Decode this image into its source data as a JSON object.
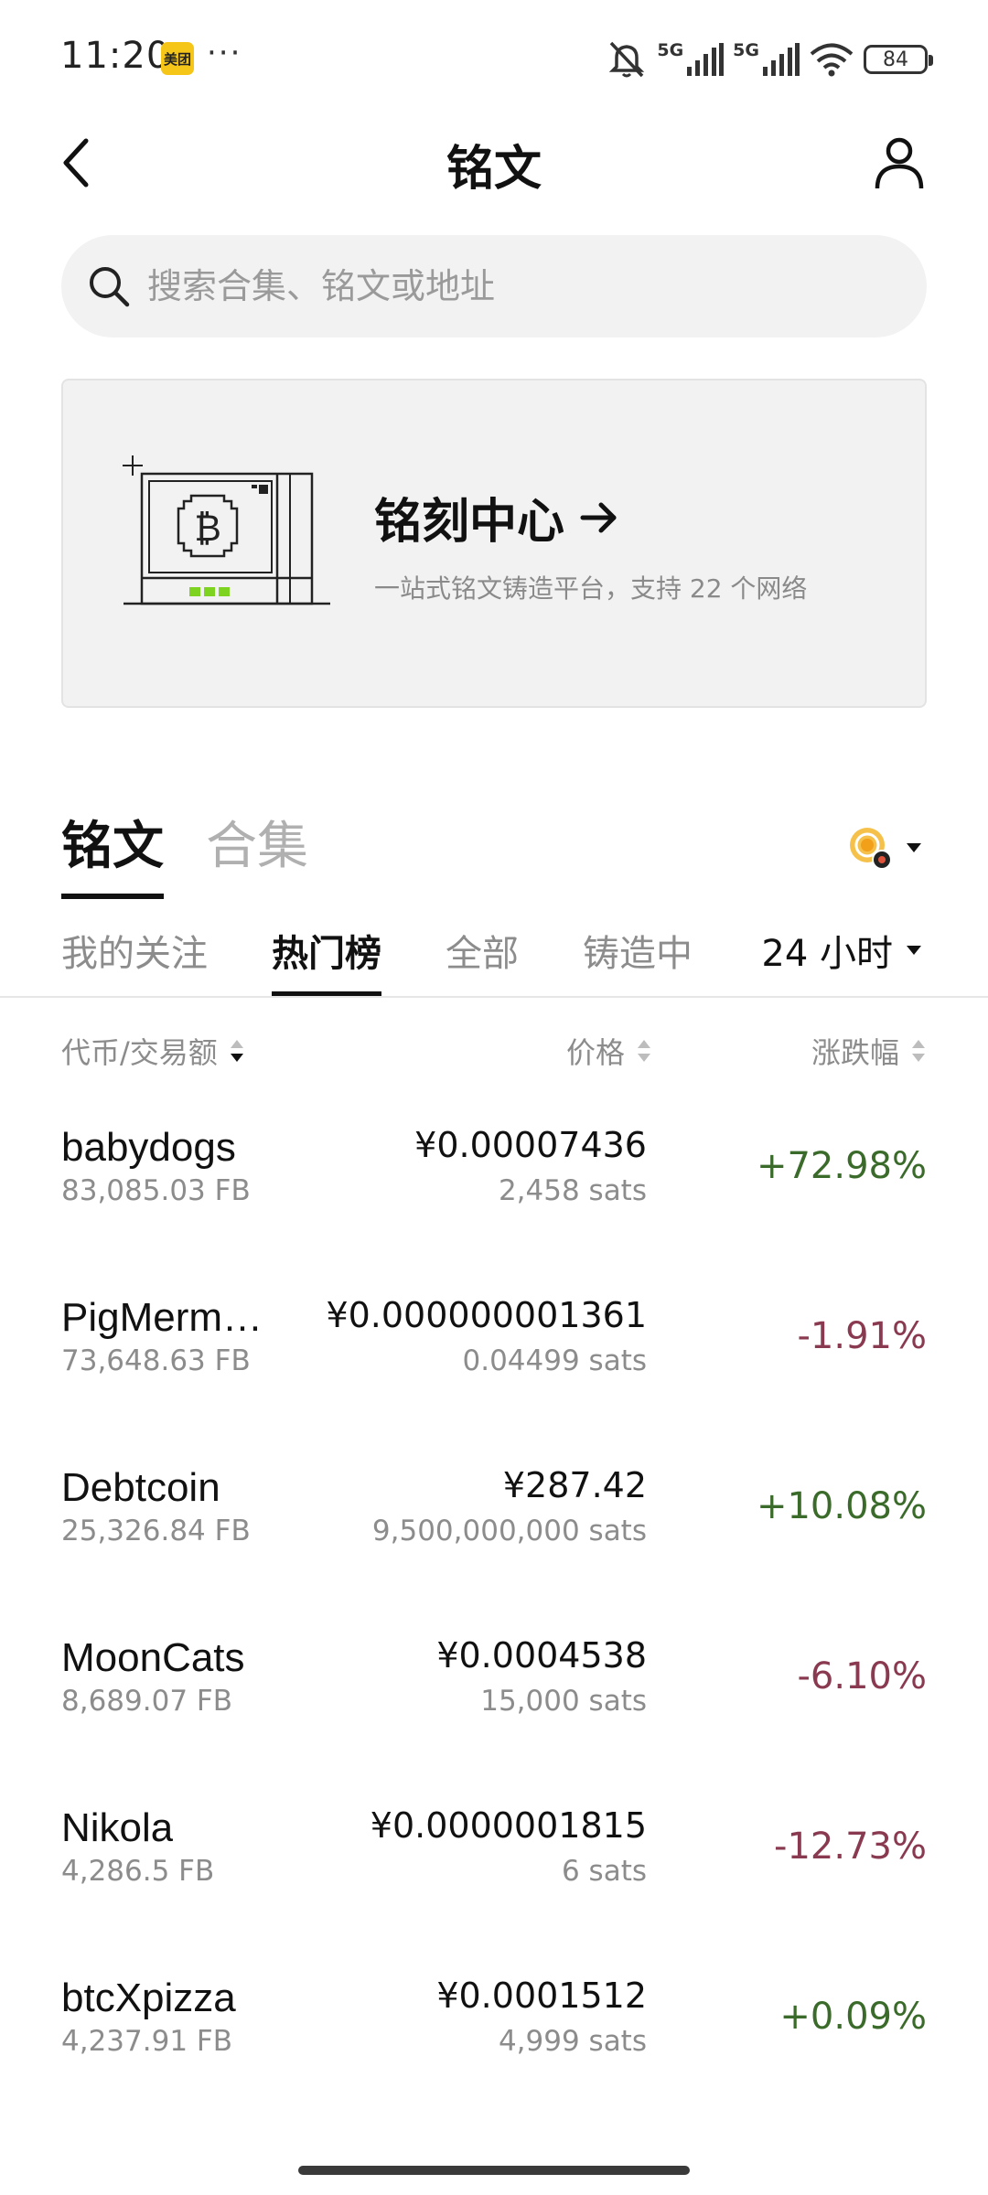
{
  "status_bar": {
    "time": "11:20",
    "meituan_badge": "美团",
    "more_dots": "···",
    "net1": "5G",
    "net2": "5G",
    "battery": "84"
  },
  "header": {
    "title": "铭文"
  },
  "search": {
    "placeholder": "搜索合集、铭文或地址"
  },
  "banner": {
    "title": "铭刻中心",
    "subtitle": "一站式铭文铸造平台，支持 22 个网络"
  },
  "main_tabs": [
    {
      "label": "铭文",
      "active": true
    },
    {
      "label": "合集",
      "active": false
    }
  ],
  "sub_tabs": [
    {
      "label": "我的关注",
      "active": false
    },
    {
      "label": "热门榜",
      "active": true
    },
    {
      "label": "全部",
      "active": false
    },
    {
      "label": "铸造中",
      "active": false
    }
  ],
  "time_filter": "24 小时",
  "columns": {
    "token": "代币/交易额",
    "price": "价格",
    "change": "涨跌幅"
  },
  "rows": [
    {
      "name": "babydogs",
      "volume": "83,085.03 FB",
      "price": "¥0.00007436",
      "sats": "2,458 sats",
      "change": "+72.98%",
      "direction": "up"
    },
    {
      "name": "PigMerm…",
      "volume": "73,648.63 FB",
      "price": "¥0.000000001361",
      "sats": "0.04499 sats",
      "change": "-1.91%",
      "direction": "down"
    },
    {
      "name": "Debtcoin",
      "volume": "25,326.84 FB",
      "price": "¥287.42",
      "sats": "9,500,000,000 sats",
      "change": "+10.08%",
      "direction": "up"
    },
    {
      "name": "MoonCats",
      "volume": "8,689.07 FB",
      "price": "¥0.0004538",
      "sats": "15,000 sats",
      "change": "-6.10%",
      "direction": "down"
    },
    {
      "name": "Nikola",
      "volume": "4,286.5 FB",
      "price": "¥0.0000001815",
      "sats": "6 sats",
      "change": "-12.73%",
      "direction": "down"
    },
    {
      "name": "btcXpizza",
      "volume": "4,237.91 FB",
      "price": "¥0.0001512",
      "sats": "4,999 sats",
      "change": "+0.09%",
      "direction": "up"
    }
  ],
  "colors": {
    "positive": "#3b6b2a",
    "negative": "#8a3a50",
    "accent_bitcoin_green": "#7ed321"
  }
}
